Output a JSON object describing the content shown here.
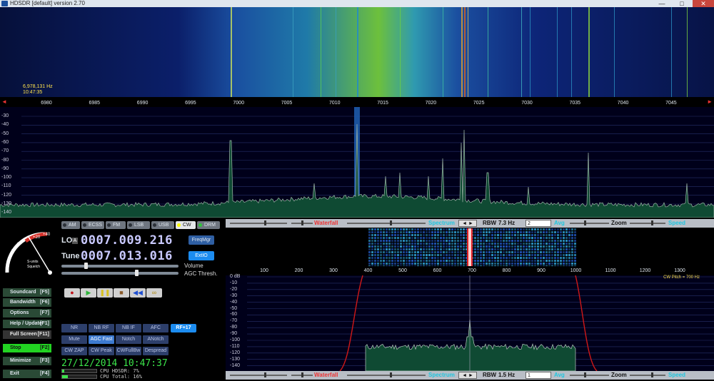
{
  "window": {
    "title": "HDSDR [default]  version 2.70",
    "min": "—",
    "max": "□",
    "close": "✕"
  },
  "waterfall": {
    "freq_readout": "6,978,131 Hz",
    "time_readout": "10:47:35"
  },
  "freq_scale": {
    "labels": [
      "6980",
      "6985",
      "6990",
      "6995",
      "7000",
      "7005",
      "7010",
      "7015",
      "7020",
      "7025",
      "7030",
      "7035",
      "7040",
      "7045"
    ],
    "left_arrow": "◄",
    "right_arrow": "►"
  },
  "spectrum": {
    "db_labels": [
      "-30",
      "-40",
      "-50",
      "-60",
      "-70",
      "-80",
      "-90",
      "-100",
      "-110",
      "-120",
      "-130",
      "-140"
    ]
  },
  "modes": [
    {
      "label": "AM",
      "active": false
    },
    {
      "label": "ECSS",
      "active": false
    },
    {
      "label": "FM",
      "active": false
    },
    {
      "label": "LSB",
      "active": false
    },
    {
      "label": "USB",
      "active": false
    },
    {
      "label": "CW",
      "active": true
    },
    {
      "label": "DRM",
      "active": false
    }
  ],
  "smeter": {
    "labels": [
      "+40",
      "+20",
      "9",
      "7",
      "5",
      "3",
      "1"
    ],
    "caption1": "S-units",
    "caption2": "Squelch"
  },
  "lo": {
    "label": "LO",
    "ab": "A",
    "value": "0007.009.216",
    "button": "FreqMgr"
  },
  "tune": {
    "label": "Tune",
    "value": "0007.013.016",
    "button": "ExtIO"
  },
  "sliders": {
    "volume": "Volume",
    "agc": "AGC Thresh.",
    "volume_level": 0.2,
    "agc_level": 0.65
  },
  "side_buttons": [
    {
      "label": "Soundcard",
      "key": "[F5]",
      "style": "normal"
    },
    {
      "label": "Bandwidth",
      "key": "[F6]",
      "style": "normal"
    },
    {
      "label": "Options",
      "key": "[F7]",
      "style": "normal"
    },
    {
      "label": "Help / Update",
      "key": "[F1]",
      "style": "normal"
    },
    {
      "label": "Full Screen",
      "key": "[F11]",
      "style": "dark"
    },
    {
      "label": "Stop",
      "key": "[F2]",
      "style": "green"
    },
    {
      "label": "Minimize",
      "key": "[F3]",
      "style": "normal"
    },
    {
      "label": "Exit",
      "key": "[F4]",
      "style": "normal"
    }
  ],
  "transport": [
    {
      "name": "record-button",
      "glyph": "●",
      "color": "#c0131a"
    },
    {
      "name": "play-button",
      "glyph": "▶",
      "color": "#2fb43a"
    },
    {
      "name": "pause-button",
      "glyph": "❚❚",
      "color": "#d8c020"
    },
    {
      "name": "stop-record-button",
      "glyph": "■",
      "color": "#8a5a2a"
    },
    {
      "name": "rewind-button",
      "glyph": "◀◀",
      "color": "#1f4fd0"
    },
    {
      "name": "loop-button",
      "glyph": "∞",
      "color": "#b08a10"
    }
  ],
  "dsp_rows": [
    [
      "NR",
      "NB RF",
      "NB IF",
      "AFC"
    ],
    [
      "Mute",
      "AGC Fast",
      "Notch",
      "ANotch"
    ],
    [
      "CW ZAP",
      "CW Peak",
      "CWFullBw",
      "Despread"
    ]
  ],
  "dsp_active": [
    "AGC Fast"
  ],
  "rf_button": "RF+17",
  "clock": "27/12/2014 10:47:37",
  "cpu": {
    "hdsdr": "CPU HDSDR:  7%",
    "total": "CPU Total: 16%",
    "hdsdr_level": 0.07,
    "total_level": 0.16
  },
  "top_ctl": {
    "waterfall": "Waterfall",
    "spectrum": "Spectrum",
    "rbw_label": "RBW",
    "rbw_value": "7.3 Hz",
    "avg_select": "2",
    "avg": "Avg",
    "zoom": "Zoom",
    "speed": "Speed"
  },
  "bottom_ctl": {
    "waterfall": "Waterfall",
    "spectrum": "Spectrum",
    "rbw_label": "RBW",
    "rbw_value": "1.5 Hz",
    "avg_select": "1",
    "avg": "Avg",
    "zoom": "Zoom",
    "speed": "Speed"
  },
  "audio_scale": {
    "labels": [
      "100",
      "200",
      "300",
      "400",
      "500",
      "600",
      "700",
      "800",
      "900",
      "1000",
      "1100",
      "1200",
      "1300"
    ]
  },
  "audio_spec": {
    "db_labels": [
      "0 dB",
      "-10",
      "-20",
      "-30",
      "-40",
      "-50",
      "-60",
      "-70",
      "-80",
      "-90",
      "-100",
      "-110",
      "-120",
      "-130",
      "-140"
    ],
    "cw_pitch": "CW Pitch = 700 Hz"
  }
}
